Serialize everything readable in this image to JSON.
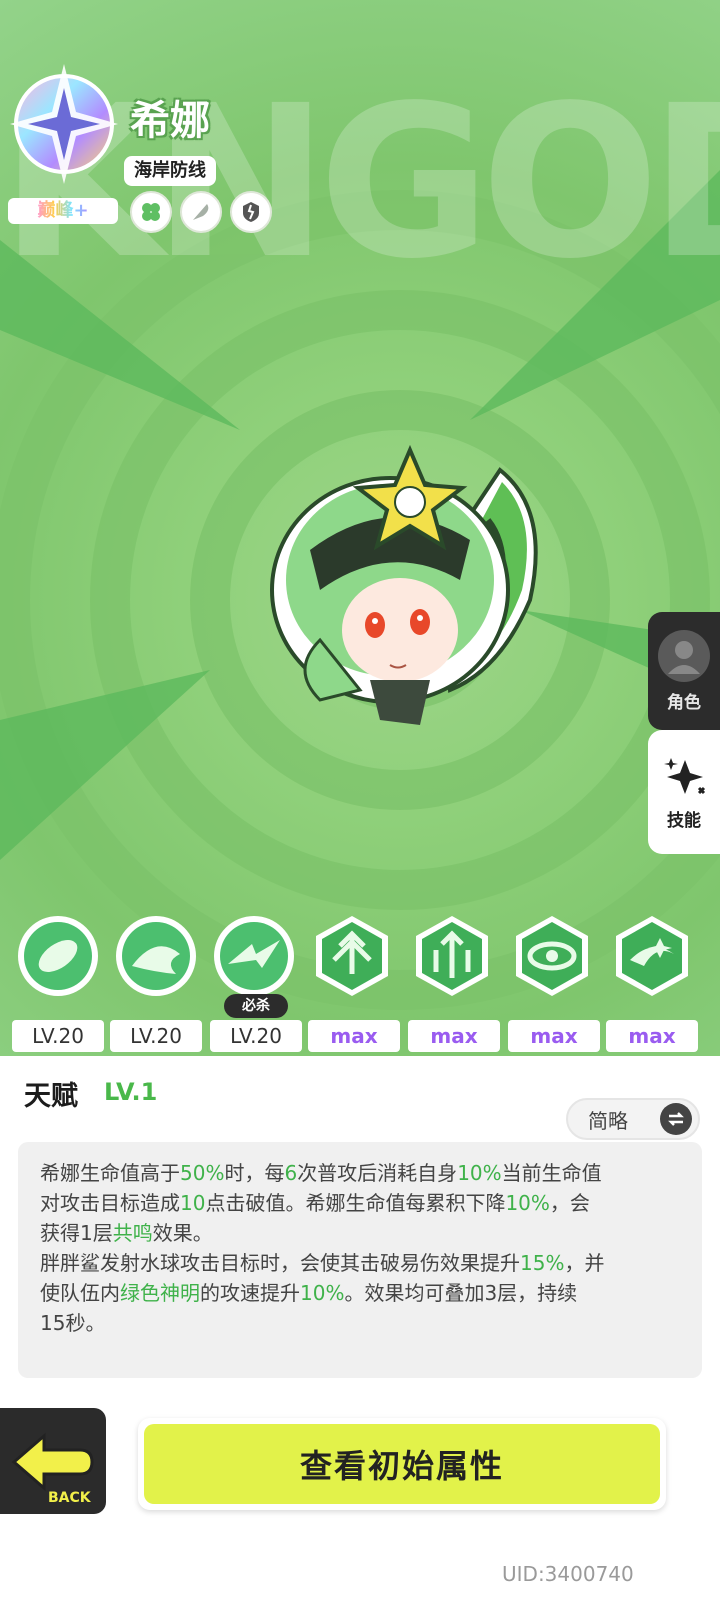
{
  "hero": {
    "name": "希娜",
    "team": "海岸防线",
    "rank": "巅峰+",
    "watermark": "KNGOD",
    "trait_icons": [
      "clover-icon",
      "feather-icon",
      "broken-shield-icon"
    ]
  },
  "side_tabs": [
    {
      "label": "角色",
      "icon": "avatar-icon"
    },
    {
      "label": "技能",
      "icon": "sparkle-icon"
    }
  ],
  "skills": [
    {
      "level": "LV.20",
      "icon": "leaf-blade-icon",
      "tag": ""
    },
    {
      "level": "LV.20",
      "icon": "shark-icon",
      "tag": ""
    },
    {
      "level": "LV.20",
      "icon": "wave-dash-icon",
      "tag": "必杀"
    },
    {
      "level": "max",
      "icon": "triple-arrow-icon",
      "tag": ""
    },
    {
      "level": "max",
      "icon": "upward-arrows-icon",
      "tag": ""
    },
    {
      "level": "max",
      "icon": "vortex-eye-icon",
      "tag": ""
    },
    {
      "level": "max",
      "icon": "spin-star-icon",
      "tag": ""
    }
  ],
  "talent": {
    "title": "天赋",
    "level": "LV.1",
    "toggle_label": "简略",
    "lines": [
      [
        {
          "t": "希娜生命值高于",
          "h": false
        },
        {
          "t": "50%",
          "h": true
        },
        {
          "t": "时，每",
          "h": false
        },
        {
          "t": "6",
          "h": true
        },
        {
          "t": "次普攻后消耗自身",
          "h": false
        },
        {
          "t": "10%",
          "h": true
        },
        {
          "t": "当前生命值",
          "h": false
        }
      ],
      [
        {
          "t": "对攻击目标造成",
          "h": false
        },
        {
          "t": "10",
          "h": true
        },
        {
          "t": "点击破值。希娜生命值每累积下降",
          "h": false
        },
        {
          "t": "10%",
          "h": true
        },
        {
          "t": "，会",
          "h": false
        }
      ],
      [
        {
          "t": "获得1层",
          "h": false
        },
        {
          "t": "共鸣",
          "h": true
        },
        {
          "t": "效果。",
          "h": false
        }
      ],
      [
        {
          "t": "胖胖鲨发射水球攻击目标时，会使其击破易伤效果提升",
          "h": false
        },
        {
          "t": "15%",
          "h": true
        },
        {
          "t": "，并",
          "h": false
        }
      ],
      [
        {
          "t": "使队伍内",
          "h": false
        },
        {
          "t": "绿色神明",
          "h": true
        },
        {
          "t": "的攻速提升",
          "h": false
        },
        {
          "t": "10%",
          "h": true
        },
        {
          "t": "。效果均可叠加3层，持续",
          "h": false
        }
      ],
      [
        {
          "t": "15秒。",
          "h": false
        }
      ]
    ]
  },
  "buttons": {
    "back_label": "BACK",
    "main_label": "查看初始属性"
  },
  "uid": "UID:3400740",
  "colors": {
    "accent_green": "#3fb24a",
    "max_purple": "#9a5cf0",
    "button_yellow": "#e2f24a",
    "hero_bg": "#8fd07a"
  }
}
